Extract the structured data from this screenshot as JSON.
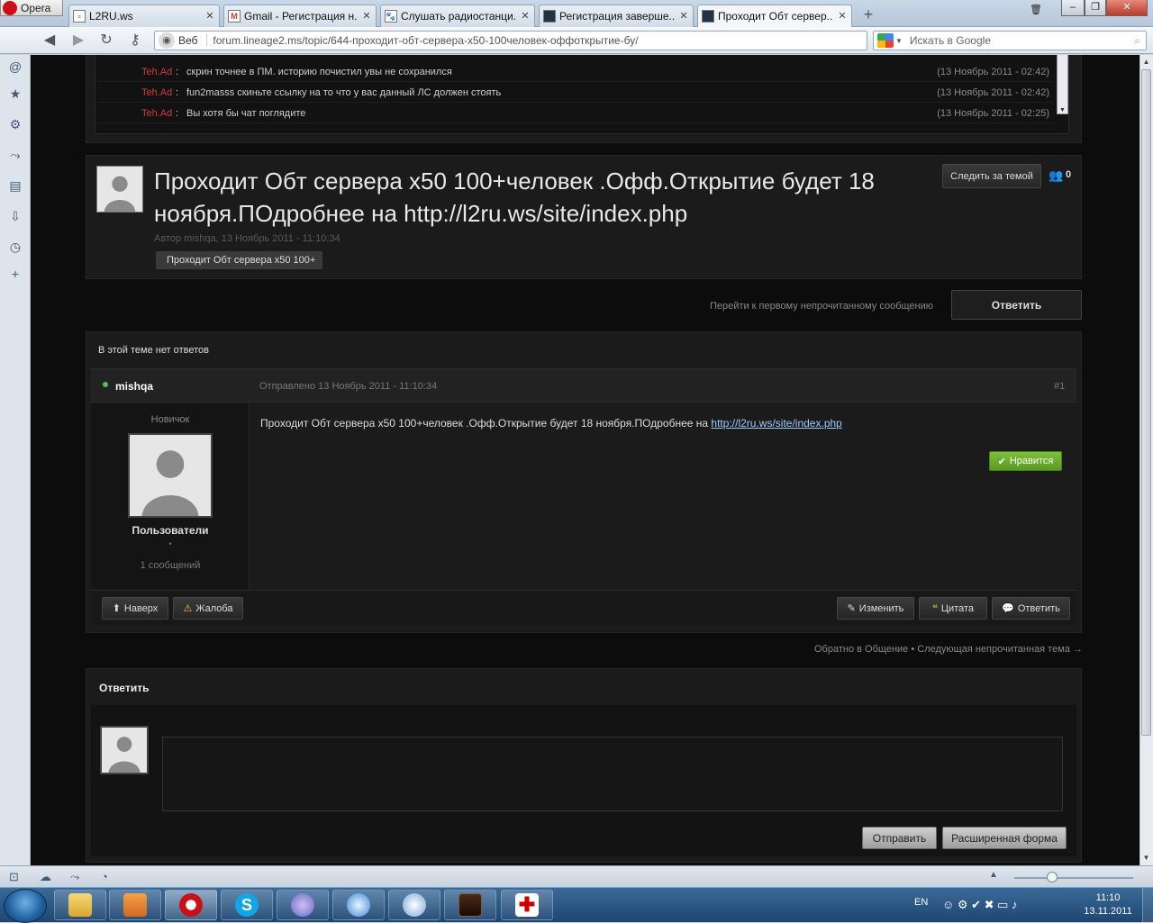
{
  "browser": {
    "menu_label": "Opera",
    "tabs": [
      {
        "label": "L2RU.ws"
      },
      {
        "label": "Gmail - Регистрация н..."
      },
      {
        "label": "Слушать радиостанци..."
      },
      {
        "label": "Регистрация заверше..."
      },
      {
        "label": "Проходит Обт сервер..."
      }
    ],
    "address": {
      "scheme_label": "Веб",
      "url": "forum.lineage2.ms/topic/644-проходит-обт-сервера-x50-100человек-оффоткрытие-бу/"
    },
    "search": {
      "placeholder": "Искать в Google"
    }
  },
  "chat": {
    "rows": [
      {
        "user": "Teh.Ad",
        "sep": ":",
        "message": "скрин точнее в ПМ. историю почистил увы не сохранился",
        "time": "(13 Ноябрь 2011 - 02:42)"
      },
      {
        "user": "Teh.Ad",
        "sep": ":",
        "message": "fun2masss скиньте ссылку на то что у вас данный ЛС должен стоять",
        "time": "(13 Ноябрь 2011 - 02:42)"
      },
      {
        "user": "Teh.Ad",
        "sep": ":",
        "message": "Вы хотя бы чат поглядите",
        "time": "(13 Ноябрь 2011 - 02:25)"
      }
    ]
  },
  "topic": {
    "title_line1": "Проходит Обт сервера x50 100+человек .Офф.Открытие будет 18",
    "title_line2": "ноября.ПОдробнее на http://l2ru.ws/site/index.php",
    "meta": "Автор mishqa, 13 Ноябрь 2011 - 11:10:34",
    "tag": "Проходит Обт сервера x50 100+",
    "follow_label": "Следить за темой",
    "followers": "0",
    "unread_link": "Перейти к первому непрочитанному сообщению",
    "reply_button": "Ответить"
  },
  "post": {
    "no_replies": "В этой теме нет ответов",
    "author": "mishqa",
    "posted": "Отправлено 13 Ноябрь 2011 - 11:10:34",
    "number": "#1",
    "rank": "Новичок",
    "group": "Пользователи",
    "dot": "•",
    "post_count": "1 сообщений",
    "body_text": "Проходит Обт сервера x50 100+человек .Офф.Открытие будет 18 ноября.ПОдробнее на ",
    "body_link": "http://l2ru.ws/site/index.php",
    "like_label": "Нравится",
    "top_label": "Наверх",
    "report_label": "Жалоба",
    "edit_label": "Изменить",
    "quote_label": "Цитата",
    "reply_label": "Ответить"
  },
  "nav": {
    "back": "Обратно в Общение",
    "bullet": "•",
    "next": "Следующая непрочитанная тема →"
  },
  "quick_reply": {
    "heading": "Ответить",
    "send_label": "Отправить",
    "advanced_label": "Расширенная форма"
  },
  "taskbar": {
    "lang": "EN",
    "time": "11:10",
    "date": "13.11.2011"
  },
  "colors": {
    "accent_green": "#6fae2c",
    "username_red": "#d23a3a",
    "online_dot": "#5cb85c"
  }
}
